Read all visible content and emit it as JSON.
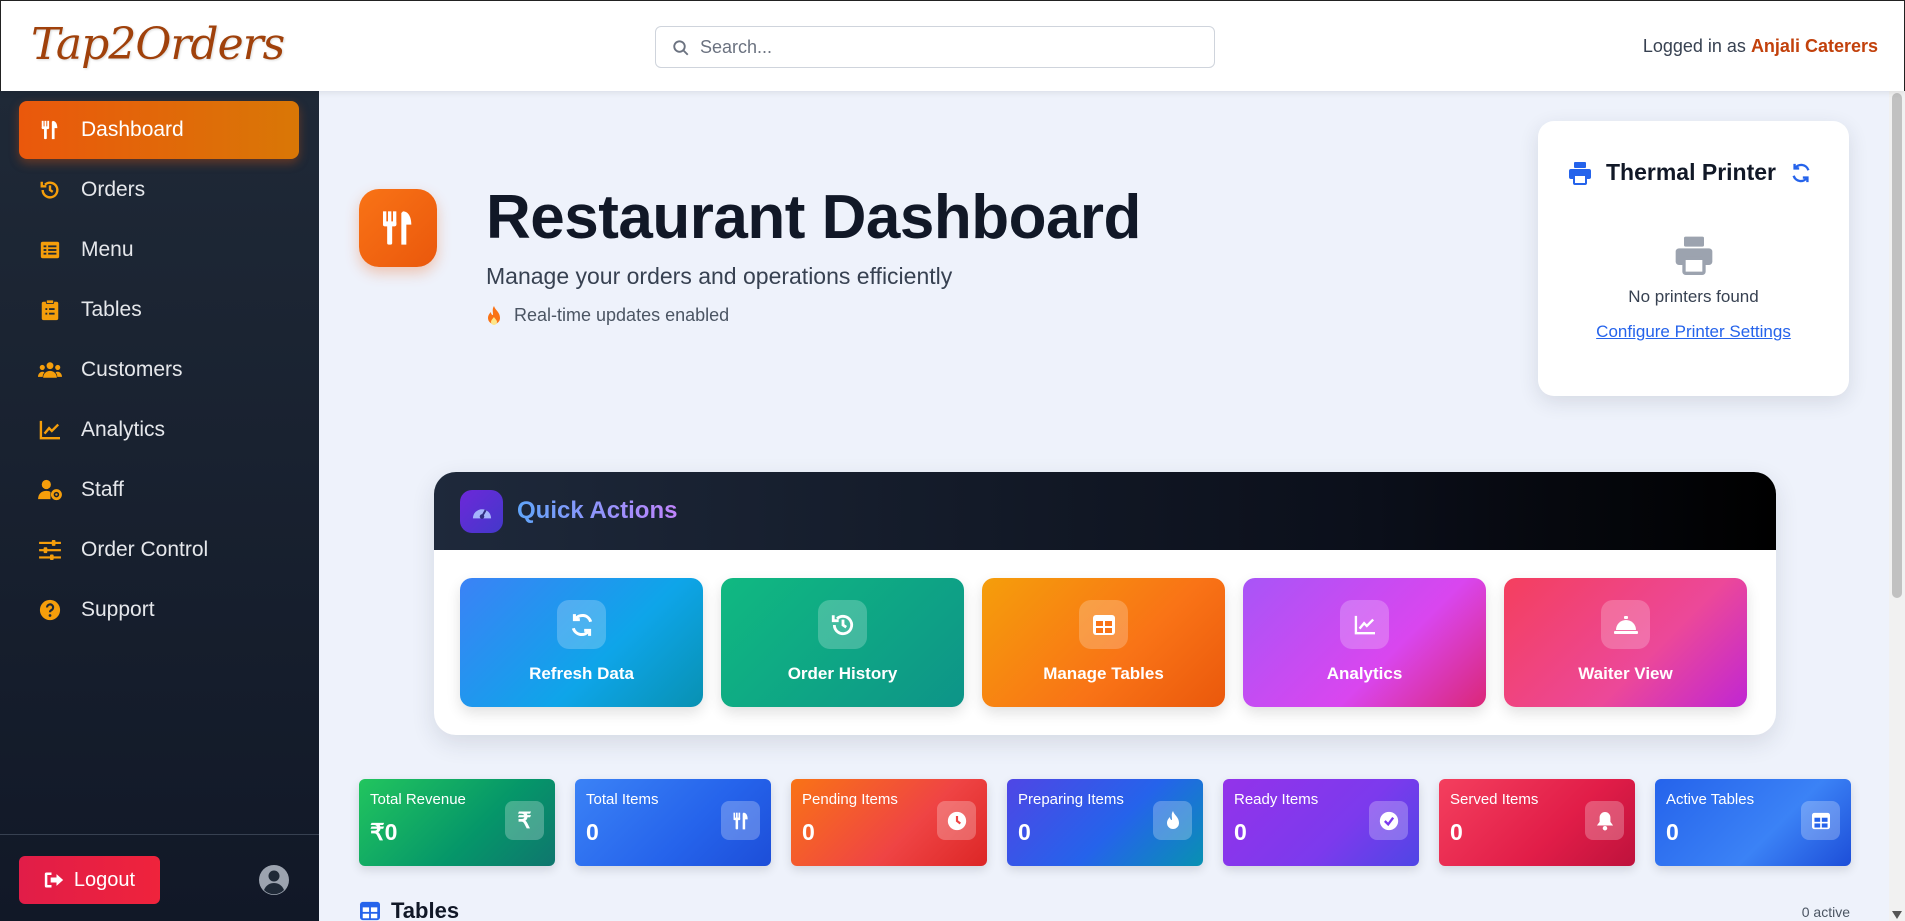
{
  "header": {
    "logo": "Tap2Orders",
    "search_placeholder": "Search...",
    "login_prefix": "Logged in as",
    "login_user": "Anjali Caterers"
  },
  "sidebar": {
    "items": [
      {
        "label": "Dashboard",
        "icon": "utensils-icon"
      },
      {
        "label": "Orders",
        "icon": "history-icon"
      },
      {
        "label": "Menu",
        "icon": "list-icon"
      },
      {
        "label": "Tables",
        "icon": "clipboard-icon"
      },
      {
        "label": "Customers",
        "icon": "users-icon"
      },
      {
        "label": "Analytics",
        "icon": "chart-line-icon"
      },
      {
        "label": "Staff",
        "icon": "user-gear-icon"
      },
      {
        "label": "Order Control",
        "icon": "sliders-icon"
      },
      {
        "label": "Support",
        "icon": "question-circle-icon"
      }
    ],
    "logout_label": "Logout"
  },
  "hero": {
    "title": "Restaurant Dashboard",
    "subtitle": "Manage your orders and operations efficiently",
    "realtime": "Real-time updates enabled"
  },
  "printer": {
    "title": "Thermal Printer",
    "status": "No printers found",
    "configure_link": "Configure Printer Settings"
  },
  "quick_actions": {
    "title": "Quick Actions",
    "buttons": [
      {
        "label": "Refresh Data",
        "icon": "refresh-icon"
      },
      {
        "label": "Order History",
        "icon": "history-icon"
      },
      {
        "label": "Manage Tables",
        "icon": "table-icon"
      },
      {
        "label": "Analytics",
        "icon": "chart-line-icon"
      },
      {
        "label": "Waiter View",
        "icon": "concierge-bell-icon"
      }
    ]
  },
  "stats": [
    {
      "label": "Total Revenue",
      "value": "₹0",
      "icon": "rupee-icon"
    },
    {
      "label": "Total Items",
      "value": "0",
      "icon": "utensils-icon"
    },
    {
      "label": "Pending Items",
      "value": "0",
      "icon": "clock-icon"
    },
    {
      "label": "Preparing Items",
      "value": "0",
      "icon": "fire-icon"
    },
    {
      "label": "Ready Items",
      "value": "0",
      "icon": "check-circle-icon"
    },
    {
      "label": "Served Items",
      "value": "0",
      "icon": "bell-icon"
    },
    {
      "label": "Active Tables",
      "value": "0",
      "icon": "table-icon"
    }
  ],
  "tables_section": {
    "title": "Tables",
    "count": "0 active"
  },
  "colors": {
    "accent_orange": "#ea580c",
    "sidebar_bg": "#1f2937",
    "link_blue": "#2563eb",
    "logout_red": "#e11d48"
  }
}
